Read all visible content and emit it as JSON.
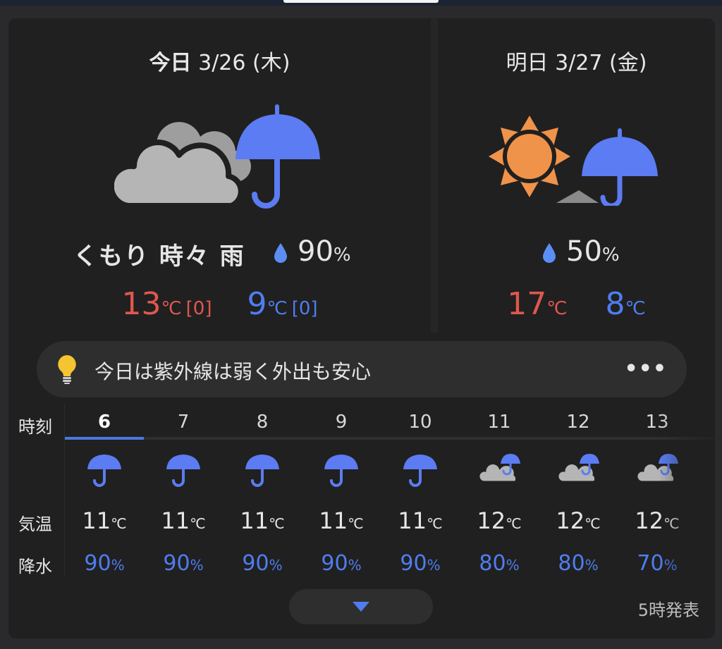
{
  "today": {
    "label": "今日",
    "date": "3/26 (木)",
    "condition": "くもり 時々 雨",
    "rain": "90",
    "rain_unit": "%",
    "high": "13",
    "high_diff": "[0]",
    "low": "9",
    "low_diff": "[0]",
    "temp_unit": "℃",
    "icon": "cloud-umbrella-icon"
  },
  "tomorrow": {
    "label": "明日",
    "date": "3/27 (金)",
    "rain": "50",
    "rain_unit": "%",
    "high": "17",
    "low": "8",
    "temp_unit": "℃",
    "icon": "sun-umbrella-icon"
  },
  "tip": {
    "text": "今日は紫外線は弱く外出も安心",
    "more": "•••"
  },
  "hourly": {
    "label_time": "時刻",
    "label_temp": "気温",
    "label_rain": "降水",
    "temp_unit": "℃",
    "rain_unit": "%",
    "hours": [
      {
        "hour": "6",
        "temp": "11",
        "rain": "90",
        "icon": "umbrella"
      },
      {
        "hour": "7",
        "temp": "11",
        "rain": "90",
        "icon": "umbrella"
      },
      {
        "hour": "8",
        "temp": "11",
        "rain": "90",
        "icon": "umbrella"
      },
      {
        "hour": "9",
        "temp": "11",
        "rain": "90",
        "icon": "umbrella"
      },
      {
        "hour": "10",
        "temp": "11",
        "rain": "90",
        "icon": "umbrella"
      },
      {
        "hour": "11",
        "temp": "12",
        "rain": "80",
        "icon": "cloud-umbrella"
      },
      {
        "hour": "12",
        "temp": "12",
        "rain": "80",
        "icon": "cloud-umbrella"
      },
      {
        "hour": "13",
        "temp": "12",
        "rain": "70",
        "icon": "cloud-umbrella"
      }
    ]
  },
  "footer": {
    "issued": "5時発表"
  },
  "colors": {
    "high": "#e0574f",
    "low": "#4f7df0",
    "rain": "#4f7df0",
    "umbrella": "#5b7cf2",
    "cloud": "#b5b5b5",
    "sun": "#f0934a"
  }
}
